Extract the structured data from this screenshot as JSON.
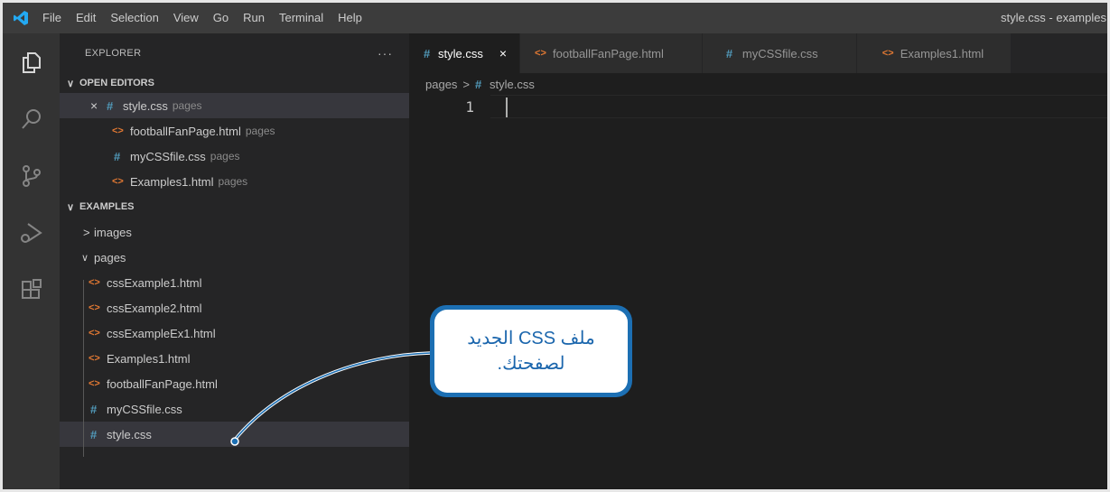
{
  "titlebar": {
    "menu": [
      "File",
      "Edit",
      "Selection",
      "View",
      "Go",
      "Run",
      "Terminal",
      "Help"
    ],
    "window_title": "style.css - examples"
  },
  "activitybar": {
    "icons": [
      "files-icon",
      "search-icon",
      "source-control-icon",
      "run-debug-icon",
      "extensions-icon"
    ]
  },
  "explorer": {
    "title": "EXPLORER",
    "more": "···",
    "open_editors": {
      "label": "OPEN EDITORS",
      "items": [
        {
          "name": "style.css",
          "folder": "pages",
          "type": "css"
        },
        {
          "name": "footballFanPage.html",
          "folder": "pages",
          "type": "html"
        },
        {
          "name": "myCSSfile.css",
          "folder": "pages",
          "type": "css"
        },
        {
          "name": "Examples1.html",
          "folder": "pages",
          "type": "html"
        }
      ]
    },
    "workspace": {
      "label": "EXAMPLES",
      "folders": [
        {
          "name": "images",
          "expanded": false
        },
        {
          "name": "pages",
          "expanded": true
        }
      ],
      "files": [
        {
          "name": "cssExample1.html",
          "type": "html"
        },
        {
          "name": "cssExample2.html",
          "type": "html"
        },
        {
          "name": "cssExampleEx1.html",
          "type": "html"
        },
        {
          "name": "Examples1.html",
          "type": "html"
        },
        {
          "name": "footballFanPage.html",
          "type": "html"
        },
        {
          "name": "myCSSfile.css",
          "type": "css"
        },
        {
          "name": "style.css",
          "type": "css"
        }
      ]
    }
  },
  "tabs": [
    {
      "label": "style.css",
      "type": "css",
      "active": true
    },
    {
      "label": "footballFanPage.html",
      "type": "html",
      "active": false
    },
    {
      "label": "myCSSfile.css",
      "type": "css",
      "active": false
    },
    {
      "label": "Examples1.html",
      "type": "html",
      "active": false
    }
  ],
  "breadcrumb": {
    "folder": "pages",
    "separator": ">",
    "file": "style.css"
  },
  "editor": {
    "line_number": "1"
  },
  "callout": {
    "line1": "ملف CSS الجديد",
    "line2": "لصفحتك."
  },
  "glyphs": {
    "css": "#",
    "html": "<>",
    "close": "×",
    "chevron_down": "∨",
    "chevron_right": ">"
  },
  "colors": {
    "accent": "#1c6fb3",
    "css_icon": "#519aba",
    "html_icon": "#e37933",
    "selection": "#37373d"
  }
}
